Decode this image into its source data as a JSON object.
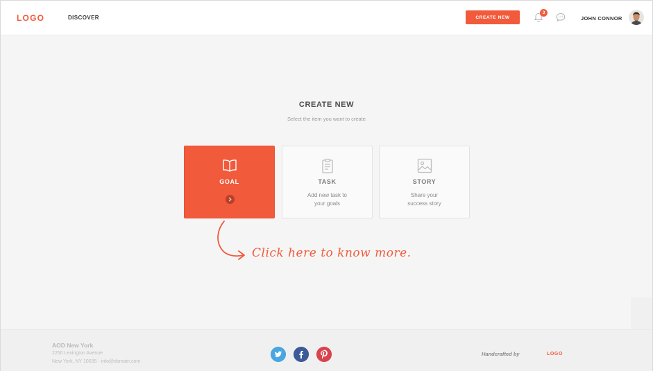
{
  "header": {
    "logo": "LOGO",
    "nav": {
      "discover": "DISCOVER"
    },
    "create_button": "CREATE NEW",
    "notifications_count": "3",
    "user_name": "JOHN CONNOR"
  },
  "main": {
    "title": "CREATE NEW",
    "subtitle": "Select the item you want to create",
    "cards": [
      {
        "title": "GOAL",
        "icon": "book-icon",
        "selected": true
      },
      {
        "title": "TASK",
        "description": "Add new task to\nyour goals",
        "icon": "clipboard-icon"
      },
      {
        "title": "STORY",
        "description": "Share your\nsuccess story",
        "icon": "image-icon"
      }
    ],
    "annotation": "Click here to know more."
  },
  "footer": {
    "address": {
      "name": "AOD New York",
      "street": "2250 Lexington Avenue",
      "city_email": "New York, NY 10035  ·  info@domain.com"
    },
    "social": [
      "twitter-icon",
      "facebook-icon",
      "pinterest-icon"
    ],
    "handcrafted_by": "Handcrafted by",
    "logo": "LOGO"
  },
  "colors": {
    "accent": "#f15a3b",
    "background": "#f5f5f5",
    "twitter": "#4aa6e0",
    "facebook": "#3d5a98",
    "pinterest": "#d8434e"
  }
}
